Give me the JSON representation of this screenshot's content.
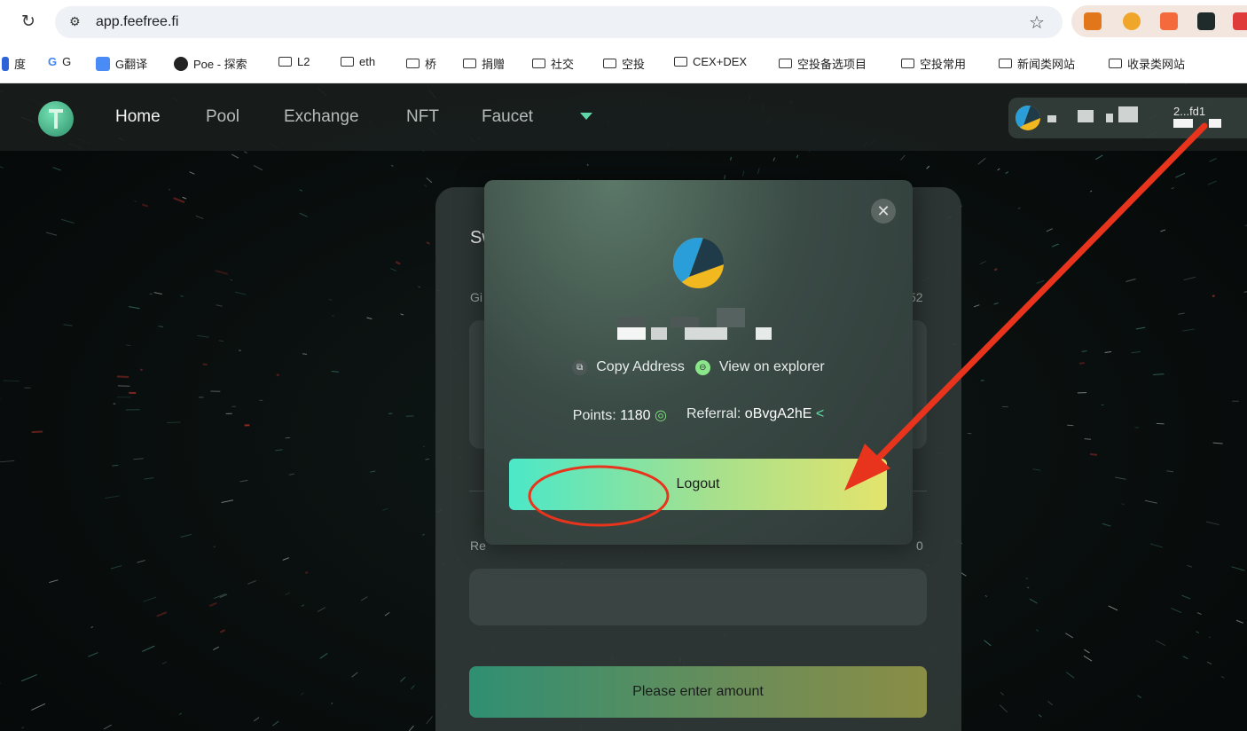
{
  "browser": {
    "url": "app.feefree.fi",
    "bookmarks": [
      {
        "label": "度",
        "type": "site"
      },
      {
        "label": "G",
        "type": "site"
      },
      {
        "label": "G翻译",
        "type": "site"
      },
      {
        "label": "Poe - 探索",
        "type": "site"
      },
      {
        "label": "L2",
        "type": "folder"
      },
      {
        "label": "eth",
        "type": "folder"
      },
      {
        "label": "桥",
        "type": "folder"
      },
      {
        "label": "捐赠",
        "type": "folder"
      },
      {
        "label": "社交",
        "type": "folder"
      },
      {
        "label": "空投",
        "type": "folder"
      },
      {
        "label": "CEX+DEX",
        "type": "folder"
      },
      {
        "label": "空投备选项目",
        "type": "folder"
      },
      {
        "label": "空投常用",
        "type": "folder"
      },
      {
        "label": "新闻类网站",
        "type": "folder"
      },
      {
        "label": "收录类网站",
        "type": "folder"
      }
    ]
  },
  "nav": {
    "items": [
      "Home",
      "Pool",
      "Exchange",
      "NFT",
      "Faucet"
    ],
    "active": "Home",
    "wallet_suffix": "2...fd1"
  },
  "swap": {
    "title": "Swap",
    "give_label": "Gi",
    "give_right": "52",
    "receive_label": "Re",
    "receive_right": "0",
    "enter_button": "Please enter amount"
  },
  "modal": {
    "copy_address": "Copy Address",
    "view_explorer": "View on explorer",
    "points_label": "Points:",
    "points_value": "1180",
    "referral_label": "Referral:",
    "referral_value": "oBvgA2hE",
    "logout": "Logout",
    "close": "✕"
  },
  "colors": {
    "accent": "#4be8c8",
    "annotation": "#e8341c"
  }
}
